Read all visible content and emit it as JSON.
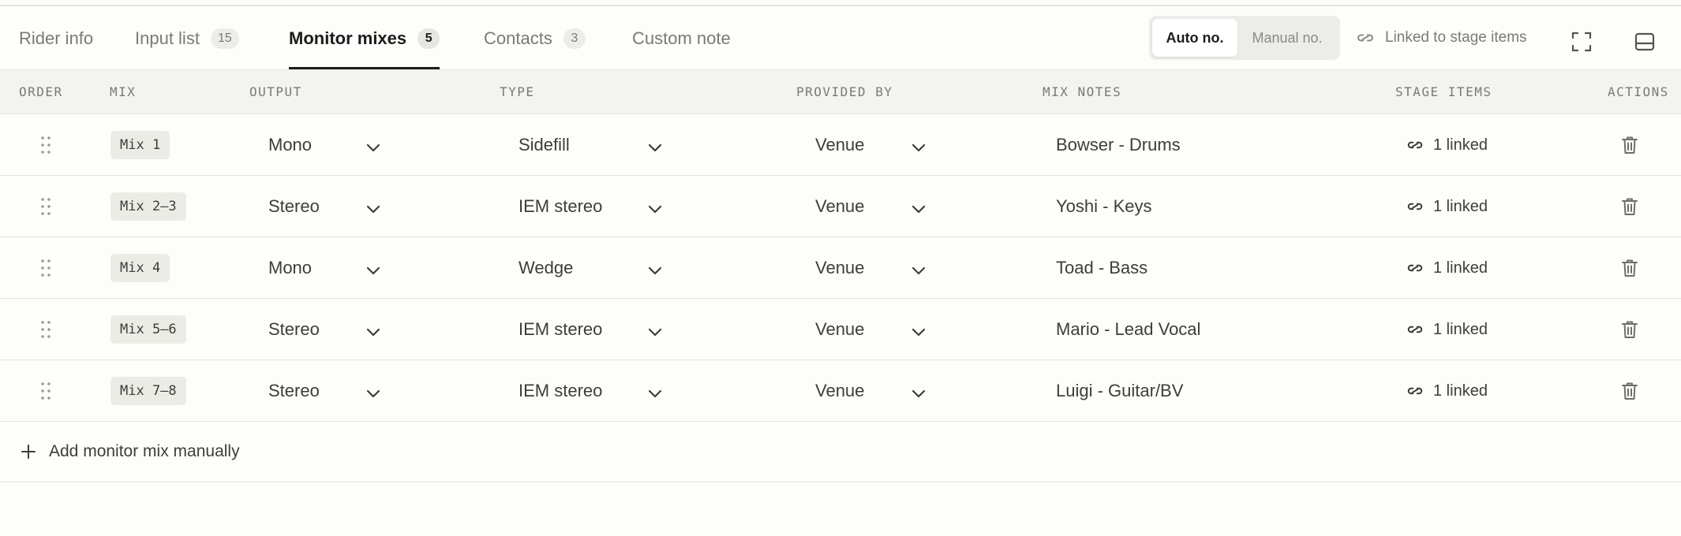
{
  "tabs": [
    {
      "label": "Rider info",
      "count": null
    },
    {
      "label": "Input list",
      "count": "15"
    },
    {
      "label": "Monitor mixes",
      "count": "5",
      "active": true
    },
    {
      "label": "Contacts",
      "count": "3"
    },
    {
      "label": "Custom note",
      "count": null
    }
  ],
  "numbering": {
    "auto_label": "Auto no.",
    "manual_label": "Manual no.",
    "selected": "Auto no."
  },
  "linked_toggle_label": "Linked to stage items",
  "toolbar_icons": [
    "expand-icon",
    "panel-layout-icon"
  ],
  "columns": {
    "order": "ORDER",
    "mix": "MIX",
    "output": "OUTPUT",
    "type": "TYPE",
    "provided_by": "PROVIDED BY",
    "mix_notes": "MIX NOTES",
    "stage_items": "STAGE ITEMS",
    "actions": "ACTIONS"
  },
  "rows": [
    {
      "mix": "Mix 1",
      "output": "Mono",
      "type": "Sidefill",
      "provided_by": "Venue",
      "notes": "Bowser - Drums",
      "stage_items": "1 linked"
    },
    {
      "mix": "Mix 2–3",
      "output": "Stereo",
      "type": "IEM stereo",
      "provided_by": "Venue",
      "notes": "Yoshi - Keys",
      "stage_items": "1 linked"
    },
    {
      "mix": "Mix 4",
      "output": "Mono",
      "type": "Wedge",
      "provided_by": "Venue",
      "notes": "Toad - Bass",
      "stage_items": "1 linked"
    },
    {
      "mix": "Mix 5–6",
      "output": "Stereo",
      "type": "IEM stereo",
      "provided_by": "Venue",
      "notes": "Mario - Lead Vocal",
      "stage_items": "1 linked"
    },
    {
      "mix": "Mix 7–8",
      "output": "Stereo",
      "type": "IEM stereo",
      "provided_by": "Venue",
      "notes": "Luigi - Guitar/BV",
      "stage_items": "1 linked"
    }
  ],
  "add_label": "Add monitor mix manually",
  "colors": {
    "background": "#fdfdfb",
    "header_bg": "#f3f3ef",
    "text": "#3d3d3a",
    "muted": "#7a7a75",
    "active": "#1c1c1a"
  }
}
